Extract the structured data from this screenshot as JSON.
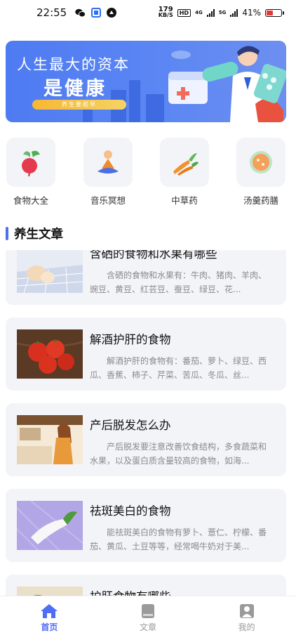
{
  "status_bar": {
    "time": "22:55",
    "speed_value": "179",
    "speed_unit": "KB/S",
    "hd_label": "HD",
    "net_4g": "4G",
    "net_5g": "5G",
    "battery_percent": "41%",
    "battery_level": 0.41,
    "battery_color": "#e53935",
    "app_icons": [
      "wechat-icon",
      "app-icon",
      "app-icon"
    ]
  },
  "banner": {
    "line1": "人生最大的资本",
    "line2": "是健康",
    "pill_text": "养生要趁早"
  },
  "categories": [
    {
      "label": "食物大全",
      "icon": "radish-icon"
    },
    {
      "label": "音乐冥想",
      "icon": "meditation-icon"
    },
    {
      "label": "中草药",
      "icon": "herb-icon"
    },
    {
      "label": "汤羹药膳",
      "icon": "soup-icon"
    }
  ],
  "section": {
    "title": "养生文章",
    "accent": "#4f6ef7"
  },
  "articles": [
    {
      "title": "含硒的食物和水果有哪些",
      "desc": "含硒的食物和水果有：牛肉、猪肉、羊肉、豌豆、黄豆、红芸豆、蚕豆、绿豆、花..."
    },
    {
      "title": "解酒护肝的食物",
      "desc": "解酒护肝的食物有：番茄、萝卜、绿豆、西瓜、香蕉、柿子、芹菜、苦瓜、冬瓜、丝..."
    },
    {
      "title": "产后脱发怎么办",
      "desc": "产后脱发要注意改善饮食结构，多食蔬菜和水果，以及蛋白质含量较高的食物，如海..."
    },
    {
      "title": "祛斑美白的食物",
      "desc": "能祛斑美白的食物有萝卜、薏仁、柠檬、番茄、黄瓜、土豆等等，经常喝牛奶对于美..."
    },
    {
      "title": "护肝食物有哪些",
      "desc": ""
    }
  ],
  "nav": {
    "items": [
      {
        "label": "首页",
        "icon": "home-icon",
        "active": true
      },
      {
        "label": "文章",
        "icon": "book-icon",
        "active": false
      },
      {
        "label": "我的",
        "icon": "profile-icon",
        "active": false
      }
    ],
    "active_color": "#4f6ef7",
    "inactive_color": "#9a9a9a"
  }
}
